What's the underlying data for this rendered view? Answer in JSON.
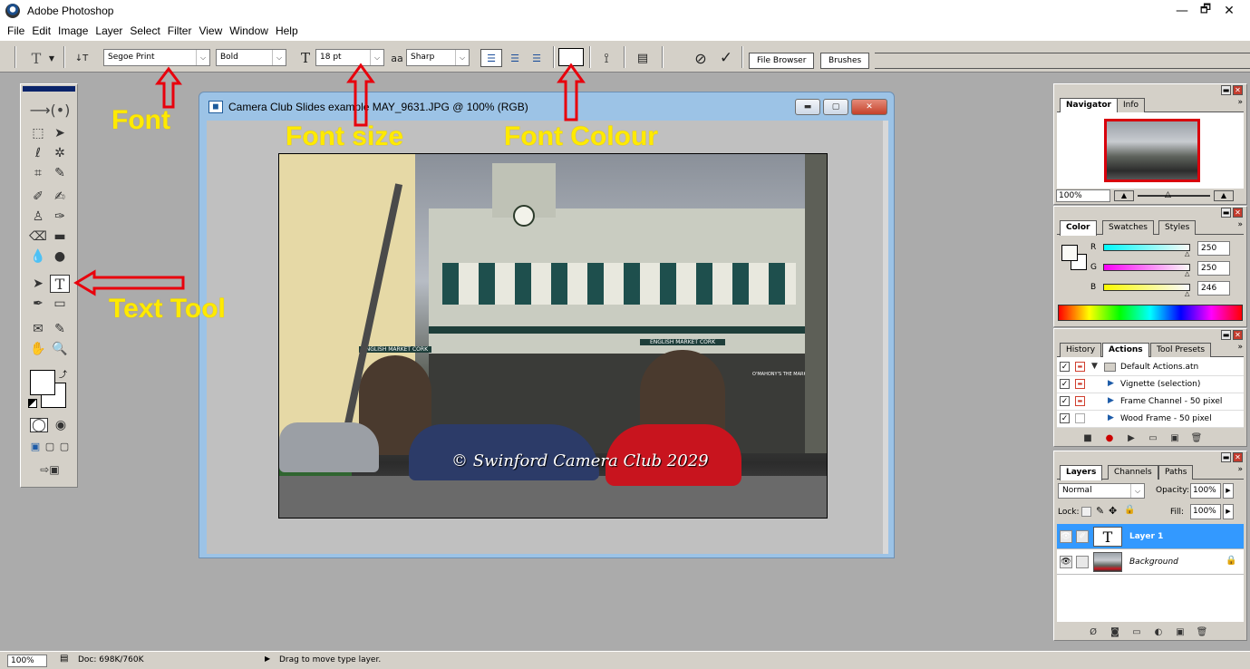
{
  "app": {
    "title": "Adobe Photoshop",
    "window_controls": {
      "minimize": "—",
      "restore": "🗗",
      "close": "✕"
    }
  },
  "menu": [
    "File",
    "Edit",
    "Image",
    "Layer",
    "Select",
    "Filter",
    "View",
    "Window",
    "Help"
  ],
  "options_bar": {
    "tool_glyph": "T",
    "orientation_glyph": "↓T",
    "font_family": "Segoe Print",
    "font_style": "Bold",
    "size_glyph": "T",
    "font_size": "18 pt",
    "aa_glyph": "aa",
    "antialias": "Sharp",
    "cancel_glyph": "⊘",
    "commit_glyph": "✓",
    "tabs": [
      "File Browser",
      "Brushes"
    ]
  },
  "document": {
    "title": "Camera Club Slides example MAY_9631.JPG @ 100% (RGB)",
    "watermark": "© Swinford Camera Club 2029",
    "signs": {
      "market_left": "ENGLISH MARKET CORK",
      "market_right": "ENGLISH MARKET CORK",
      "shop": "O'MAHONY'S THE MARKET"
    }
  },
  "annotations": {
    "font": "Font",
    "font_size": "Font size",
    "font_colour": "Font Colour",
    "text_tool": "Text Tool"
  },
  "navigator": {
    "tabs": [
      "Navigator",
      "Info"
    ],
    "zoom": "100%"
  },
  "color": {
    "tabs": [
      "Color",
      "Swatches",
      "Styles"
    ],
    "channels": [
      {
        "label": "R",
        "value": "250"
      },
      {
        "label": "G",
        "value": "250"
      },
      {
        "label": "B",
        "value": "246"
      }
    ]
  },
  "actions": {
    "tabs": [
      "History",
      "Actions",
      "Tool Presets"
    ],
    "items": [
      {
        "label": "Default Actions.atn",
        "checked": true
      },
      {
        "label": "Vignette (selection)",
        "checked": true
      },
      {
        "label": "Frame Channel - 50 pixel",
        "checked": true
      },
      {
        "label": "Wood Frame - 50 pixel",
        "checked": true
      }
    ]
  },
  "layers": {
    "tabs": [
      "Layers",
      "Channels",
      "Paths"
    ],
    "blend_mode": "Normal",
    "opacity_label": "Opacity:",
    "opacity": "100%",
    "lock_label": "Lock:",
    "fill_label": "Fill:",
    "fill": "100%",
    "items": [
      {
        "name": "Layer 1",
        "thumb": "T",
        "selected": true
      },
      {
        "name": "Background",
        "selected": false
      }
    ]
  },
  "status": {
    "zoom": "100%",
    "doc": "Doc: 698K/760K",
    "hint": "Drag to move type layer."
  },
  "colors": {
    "annotation": "#ffea00",
    "arrow": "#e8000c",
    "selection": "#3399ff",
    "ui_gray": "#d4d0c8"
  }
}
